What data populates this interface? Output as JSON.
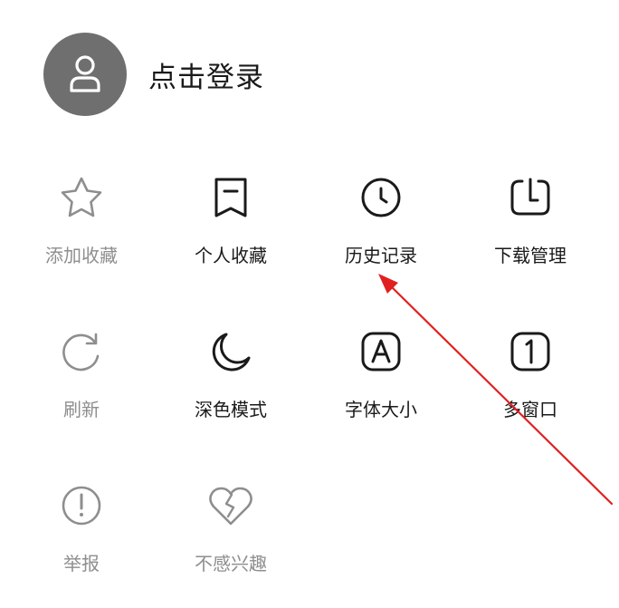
{
  "header": {
    "login_label": "点击登录"
  },
  "menu": {
    "items": [
      {
        "label": "添加收藏",
        "icon": "star-icon",
        "enabled": false
      },
      {
        "label": "个人收藏",
        "icon": "bookmark-icon",
        "enabled": true
      },
      {
        "label": "历史记录",
        "icon": "clock-icon",
        "enabled": true
      },
      {
        "label": "下载管理",
        "icon": "download-icon",
        "enabled": true
      },
      {
        "label": "刷新",
        "icon": "refresh-icon",
        "enabled": false
      },
      {
        "label": "深色模式",
        "icon": "moon-icon",
        "enabled": true
      },
      {
        "label": "字体大小",
        "icon": "font-size-icon",
        "enabled": true
      },
      {
        "label": "多窗口",
        "icon": "multi-window-icon",
        "enabled": true
      },
      {
        "label": "举报",
        "icon": "report-icon",
        "enabled": false
      },
      {
        "label": "不感兴趣",
        "icon": "broken-heart-icon",
        "enabled": false
      }
    ]
  },
  "colors": {
    "text": "#1a1a1a",
    "disabled": "#8e8e8e",
    "avatar_bg": "#6f6f6f",
    "annotation": "#e02020"
  }
}
